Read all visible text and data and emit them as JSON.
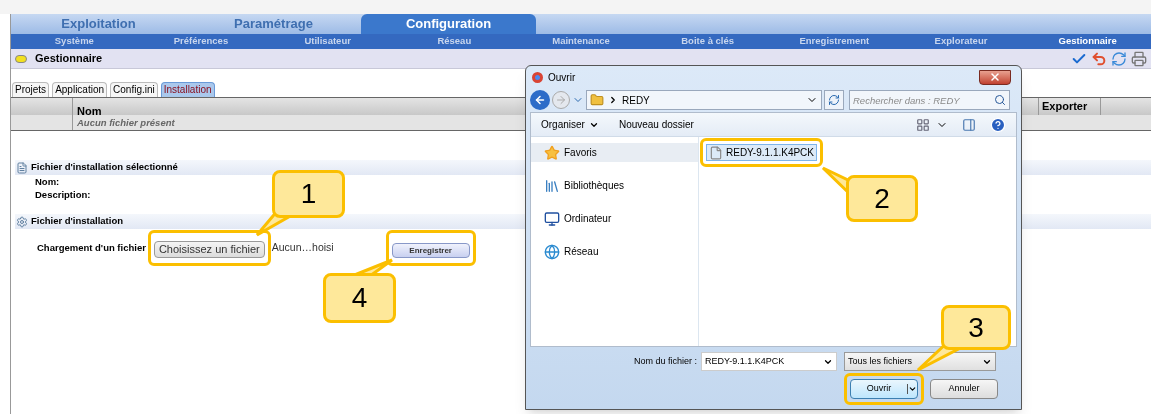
{
  "main_tabs": [
    {
      "label": "Exploitation",
      "selected": false
    },
    {
      "label": "Paramétrage",
      "selected": false
    },
    {
      "label": "Configuration",
      "selected": true
    }
  ],
  "sub_nav": [
    {
      "label": "Système",
      "selected": false
    },
    {
      "label": "Préférences",
      "selected": false
    },
    {
      "label": "Utilisateur",
      "selected": false
    },
    {
      "label": "Réseau",
      "selected": false
    },
    {
      "label": "Maintenance",
      "selected": false
    },
    {
      "label": "Boite à clés",
      "selected": false
    },
    {
      "label": "Enregistrement",
      "selected": false
    },
    {
      "label": "Explorateur",
      "selected": false
    },
    {
      "label": "Gestionnaire",
      "selected": true
    }
  ],
  "page_title": "Gestionnaire",
  "tabs": [
    {
      "label": "Projets",
      "selected": false
    },
    {
      "label": "Application",
      "selected": false
    },
    {
      "label": "Config.ini",
      "selected": false
    },
    {
      "label": "Installation",
      "selected": true
    }
  ],
  "table": {
    "columns": [
      "Nom",
      "Exporter"
    ],
    "empty_message": "Aucun fichier présent"
  },
  "selected_file_section": {
    "title": "Fichier d'installation sélectionné",
    "fields": [
      "Nom:",
      "Description:"
    ]
  },
  "install_section": {
    "title": "Fichier d'installation",
    "label": "Chargement d'un fichier",
    "choose_button": "Choisissez un fichier",
    "file_status": "Aucun…hoisi",
    "save_button": "Enregistrer"
  },
  "dialog": {
    "title": "Ouvrir",
    "path": "REDY",
    "search_placeholder": "Rechercher dans : REDY",
    "organize": "Organiser",
    "new_folder": "Nouveau dossier",
    "nav": [
      {
        "label": "Favoris",
        "kind": "favorites",
        "selected": true
      },
      {
        "label": "Bibliothèques",
        "kind": "libraries",
        "selected": false
      },
      {
        "label": "Ordinateur",
        "kind": "computer",
        "selected": false
      },
      {
        "label": "Réseau",
        "kind": "network",
        "selected": false
      }
    ],
    "files": [
      {
        "name": "REDY-9.1.1.K4PCK",
        "selected": true
      }
    ],
    "filename_label": "Nom du fichier :",
    "filename": "REDY-9.1.1.K4PCK",
    "filetype": "Tous les fichiers",
    "open_button": "Ouvrir",
    "cancel_button": "Annuler"
  },
  "callouts": [
    "1",
    "2",
    "3",
    "4"
  ]
}
